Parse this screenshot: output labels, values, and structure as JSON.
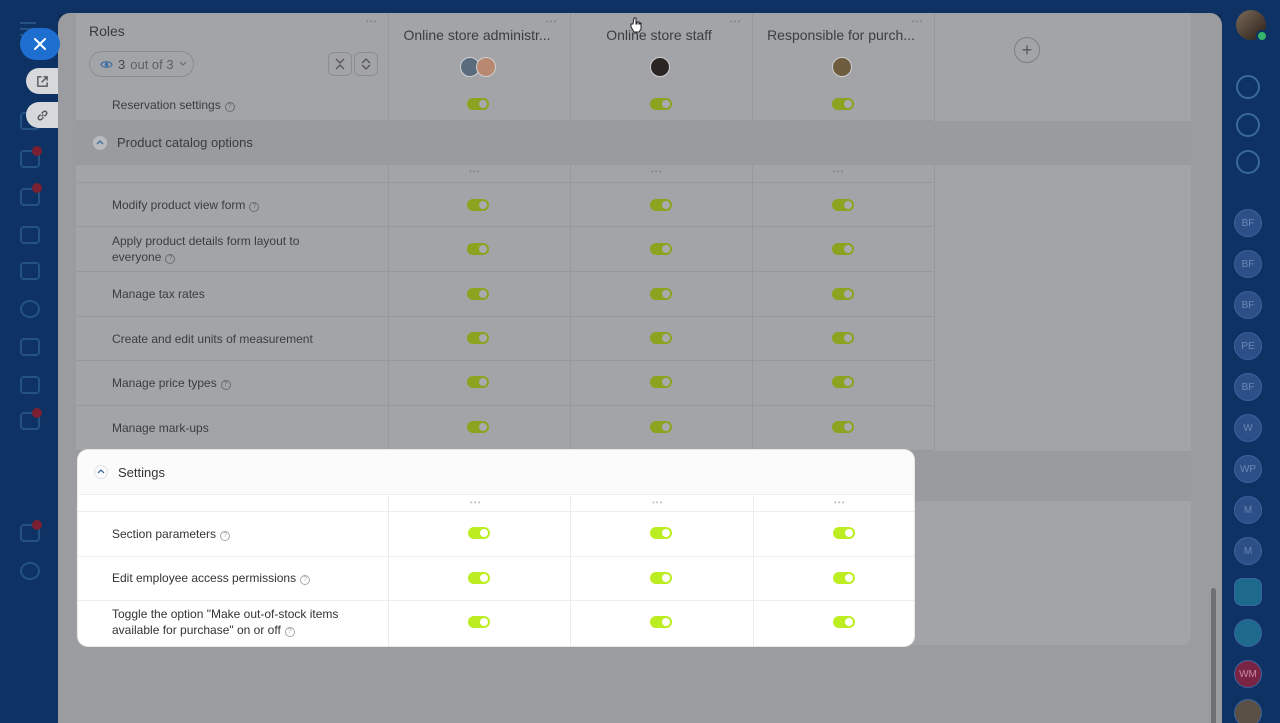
{
  "close_button": {
    "icon": "close-icon"
  },
  "side_tabs": [
    {
      "name": "open-in-new-window-tab",
      "icon": "external-link-icon"
    },
    {
      "name": "copy-link-tab",
      "icon": "link-icon"
    }
  ],
  "header": {
    "roles_title": "Roles",
    "view_selector": {
      "count": "3",
      "suffix": "out of 3"
    },
    "columns": [
      {
        "title": "Online store administr..."
      },
      {
        "title": "Online store staff"
      },
      {
        "title": "Responsible for purch..."
      }
    ],
    "add_role_icon": "plus-icon"
  },
  "rows": {
    "reservation": {
      "label": "Reservation settings"
    }
  },
  "sections": {
    "product_catalog": {
      "title": "Product catalog options",
      "rows": [
        {
          "label": "Modify product view form",
          "help": true
        },
        {
          "label": "Apply product details form layout to everyone",
          "help": true
        },
        {
          "label": "Manage tax rates",
          "help": false
        },
        {
          "label": "Create and edit units of measurement",
          "help": false
        },
        {
          "label": "Manage price types",
          "help": true
        },
        {
          "label": "Manage mark-ups",
          "help": false
        }
      ]
    },
    "settings": {
      "title": "Settings",
      "rows": [
        {
          "label": "Section parameters",
          "help": true
        },
        {
          "label": "Edit employee access permissions",
          "help": true
        },
        {
          "label": "Toggle the option \"Make out-of-stock items available for purchase\" on or off",
          "help": true
        }
      ]
    }
  },
  "right_rail": {
    "avatars": [
      "BF",
      "BF",
      "BF",
      "PE",
      "BF",
      "W",
      "WP",
      "M",
      "M",
      "WM"
    ]
  },
  "colors": {
    "toggle_on": "#bbed21",
    "accent_blue": "#1e6fd0",
    "overlay_dim": "#a3a4a7"
  }
}
